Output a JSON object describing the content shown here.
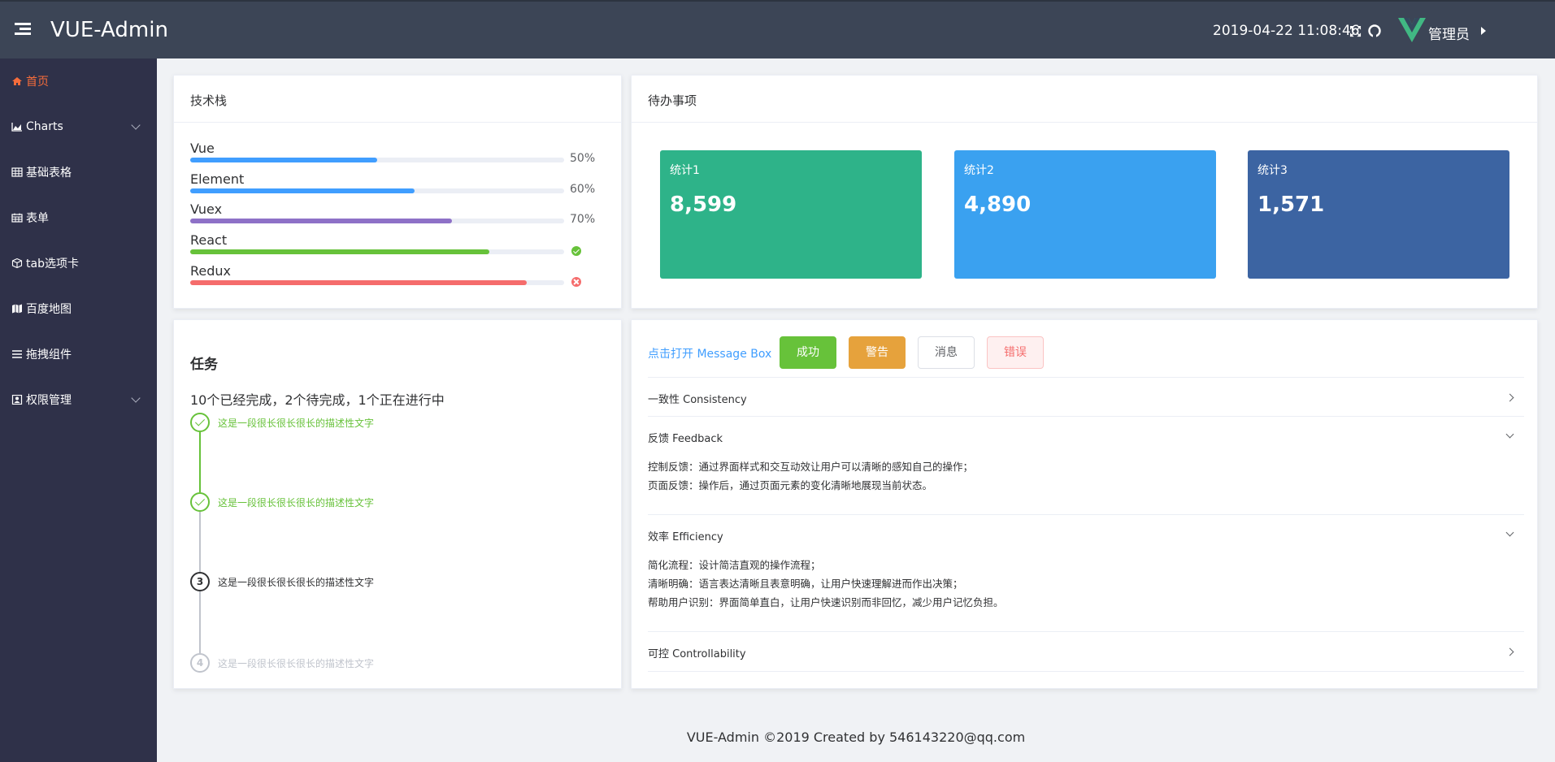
{
  "header": {
    "title": "VUE-Admin",
    "datetime": "2019-04-22 11:08:46",
    "user": "管理员",
    "brand_color": "#3c4556"
  },
  "sidebar": {
    "items": [
      {
        "label": "首页",
        "icon": "home-icon",
        "active": true,
        "expandable": false
      },
      {
        "label": "Charts",
        "icon": "area-chart-icon",
        "active": false,
        "expandable": true
      },
      {
        "label": "基础表格",
        "icon": "table-icon",
        "active": false,
        "expandable": false
      },
      {
        "label": "表单",
        "icon": "calendar-icon",
        "active": false,
        "expandable": false
      },
      {
        "label": "tab选项卡",
        "icon": "cube-icon",
        "active": false,
        "expandable": false
      },
      {
        "label": "百度地图",
        "icon": "map-icon",
        "active": false,
        "expandable": false
      },
      {
        "label": "拖拽组件",
        "icon": "list-icon",
        "active": false,
        "expandable": false
      },
      {
        "label": "权限管理",
        "icon": "user-badge-icon",
        "active": false,
        "expandable": true
      }
    ]
  },
  "tech": {
    "title": "技术栈",
    "items": [
      {
        "name": "Vue",
        "percent": 50,
        "label": "50%",
        "color": "#409eff",
        "status": "text"
      },
      {
        "name": "Element",
        "percent": 60,
        "label": "60%",
        "color": "#409eff",
        "status": "text"
      },
      {
        "name": "Vuex",
        "percent": 70,
        "label": "70%",
        "color": "#8e71c7",
        "status": "text"
      },
      {
        "name": "React",
        "percent": 80,
        "label": "",
        "color": "#67c23a",
        "status": "success"
      },
      {
        "name": "Redux",
        "percent": 90,
        "label": "",
        "color": "#f56c6c",
        "status": "exception"
      }
    ]
  },
  "todo": {
    "title": "待办事项",
    "stats": [
      {
        "label": "统计1",
        "value": "8,599",
        "color": "#2eb389"
      },
      {
        "label": "统计2",
        "value": "4,890",
        "color": "#3aa1f0"
      },
      {
        "label": "统计3",
        "value": "1,571",
        "color": "#3c64a2"
      }
    ]
  },
  "tasks": {
    "title": "任务",
    "summary": "10个已经完成，2个待完成，1个正在进行中",
    "steps": [
      {
        "text": "这是一段很长很长很长的描述性文字",
        "status": "done",
        "number": ""
      },
      {
        "text": "这是一段很长很长很长的描述性文字",
        "status": "done",
        "number": ""
      },
      {
        "text": "这是一段很长很长很长的描述性文字",
        "status": "process",
        "number": "3"
      },
      {
        "text": "这是一段很长很长很长的描述性文字",
        "status": "wait",
        "number": "4"
      }
    ]
  },
  "messages": {
    "link": "点击打开 Message Box",
    "buttons": {
      "success": "成功",
      "warning": "警告",
      "info": "消息",
      "error": "错误"
    }
  },
  "collapse": [
    {
      "title": "一致性 Consistency",
      "open": false,
      "lines": []
    },
    {
      "title": "反馈 Feedback",
      "open": true,
      "lines": [
        "控制反馈：通过界面样式和交互动效让用户可以清晰的感知自己的操作；",
        "页面反馈：操作后，通过页面元素的变化清晰地展现当前状态。"
      ]
    },
    {
      "title": "效率 Efficiency",
      "open": true,
      "lines": [
        "简化流程：设计简洁直观的操作流程；",
        "清晰明确：语言表达清晰且表意明确，让用户快速理解进而作出决策；",
        "帮助用户识别：界面简单直白，让用户快速识别而非回忆，减少用户记忆负担。"
      ]
    },
    {
      "title": "可控 Controllability",
      "open": false,
      "lines": []
    }
  ],
  "footer": "VUE-Admin ©2019 Created by 546143220@qq.com"
}
